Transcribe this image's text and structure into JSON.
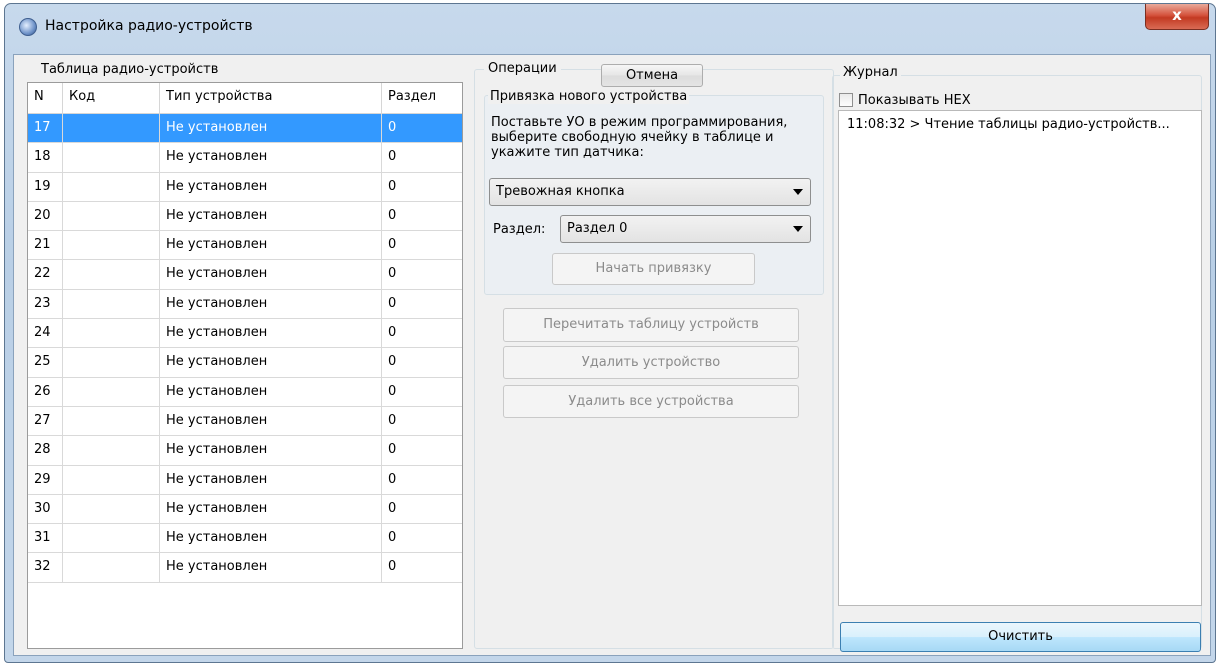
{
  "window": {
    "title": "Настройка радио-устройств",
    "close_label": "x"
  },
  "table_panel": {
    "label": "Таблица радио-устройств",
    "columns": [
      "N",
      "Код",
      "Тип устройства",
      "Раздел"
    ],
    "rows": [
      {
        "n": "17",
        "code": "",
        "type": "Не установлен",
        "section": "0"
      },
      {
        "n": "18",
        "code": "",
        "type": "Не установлен",
        "section": "0"
      },
      {
        "n": "19",
        "code": "",
        "type": "Не установлен",
        "section": "0"
      },
      {
        "n": "20",
        "code": "",
        "type": "Не установлен",
        "section": "0"
      },
      {
        "n": "21",
        "code": "",
        "type": "Не установлен",
        "section": "0"
      },
      {
        "n": "22",
        "code": "",
        "type": "Не установлен",
        "section": "0"
      },
      {
        "n": "23",
        "code": "",
        "type": "Не установлен",
        "section": "0"
      },
      {
        "n": "24",
        "code": "",
        "type": "Не установлен",
        "section": "0"
      },
      {
        "n": "25",
        "code": "",
        "type": "Не установлен",
        "section": "0"
      },
      {
        "n": "26",
        "code": "",
        "type": "Не установлен",
        "section": "0"
      },
      {
        "n": "27",
        "code": "",
        "type": "Не установлен",
        "section": "0"
      },
      {
        "n": "28",
        "code": "",
        "type": "Не установлен",
        "section": "0"
      },
      {
        "n": "29",
        "code": "",
        "type": "Не установлен",
        "section": "0"
      },
      {
        "n": "30",
        "code": "",
        "type": "Не установлен",
        "section": "0"
      },
      {
        "n": "31",
        "code": "",
        "type": "Не установлен",
        "section": "0"
      },
      {
        "n": "32",
        "code": "",
        "type": "Не установлен",
        "section": "0"
      }
    ]
  },
  "operations": {
    "label": "Операции",
    "cancel_label": "Отмена",
    "binding": {
      "label": "Привязка нового устройства",
      "instruction": "Поставьте УО в режим программирования, выберите свободную ячейку в таблице и укажите тип датчика:",
      "device_type_value": "Тревожная кнопка",
      "section_label": "Раздел:",
      "section_value": "Раздел 0",
      "start_label": "Начать привязку"
    },
    "reread_label": "Перечитать таблицу устройств",
    "delete_label": "Удалить устройство",
    "delete_all_label": "Удалить все устройства"
  },
  "log": {
    "label": "Журнал",
    "hex_label": "Показывать HEX",
    "hex_checked": false,
    "entries": [
      "11:08:32 > Чтение таблицы радио-устройств..."
    ],
    "clear_label": "Очистить"
  },
  "colors": {
    "selection": "#3399ff",
    "close_button": "#c9442b"
  }
}
